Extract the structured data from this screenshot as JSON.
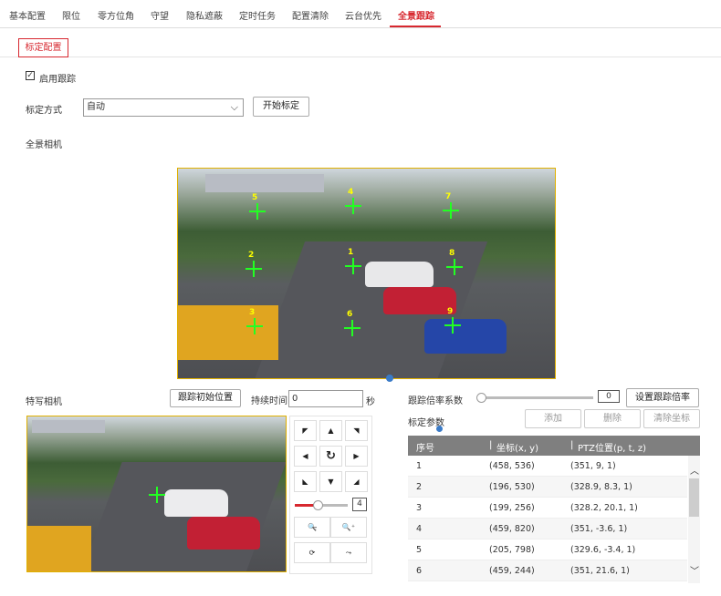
{
  "tabs": [
    "基本配置",
    "限位",
    "零方位角",
    "守望",
    "隐私遮蔽",
    "定时任务",
    "配置清除",
    "云台优先",
    "全景跟踪"
  ],
  "subtab": "标定配置",
  "enable_tracking": {
    "label": "启用跟踪",
    "checked": true
  },
  "calib_mode": {
    "label": "标定方式",
    "value": "自动",
    "start_button": "开始标定"
  },
  "panorama_label": "全景相机",
  "points": [
    "1",
    "2",
    "3",
    "4",
    "5",
    "6",
    "7",
    "8",
    "9"
  ],
  "closeup": {
    "label": "特写相机",
    "init_button": "跟踪初始位置",
    "duration_label": "持续时间",
    "duration_value": "0",
    "duration_unit": "秒"
  },
  "ptz": {
    "speed_value": "4",
    "speed_fraction": 0.4
  },
  "zoom_ratio": {
    "label": "跟踪倍率系数",
    "value": "0",
    "set_button": "设置跟踪倍率"
  },
  "params": {
    "label": "标定参数",
    "add": "添加",
    "delete": "删除",
    "clear": "清除坐标"
  },
  "table": {
    "headers": [
      "序号",
      "坐标(x, y)",
      "PTZ位置(p, t, z)"
    ],
    "rows": [
      [
        "1",
        "(458, 536)",
        "(351, 9, 1)"
      ],
      [
        "2",
        "(196, 530)",
        "(328.9, 8.3, 1)"
      ],
      [
        "3",
        "(199, 256)",
        "(328.2, 20.1, 1)"
      ],
      [
        "4",
        "(459, 820)",
        "(351, -3.6, 1)"
      ],
      [
        "5",
        "(205, 798)",
        "(329.6, -3.4, 1)"
      ],
      [
        "6",
        "(459, 244)",
        "(351, 21.6, 1)"
      ]
    ]
  },
  "colors": {
    "accent": "#d7282f",
    "marker": "#22ff22"
  }
}
